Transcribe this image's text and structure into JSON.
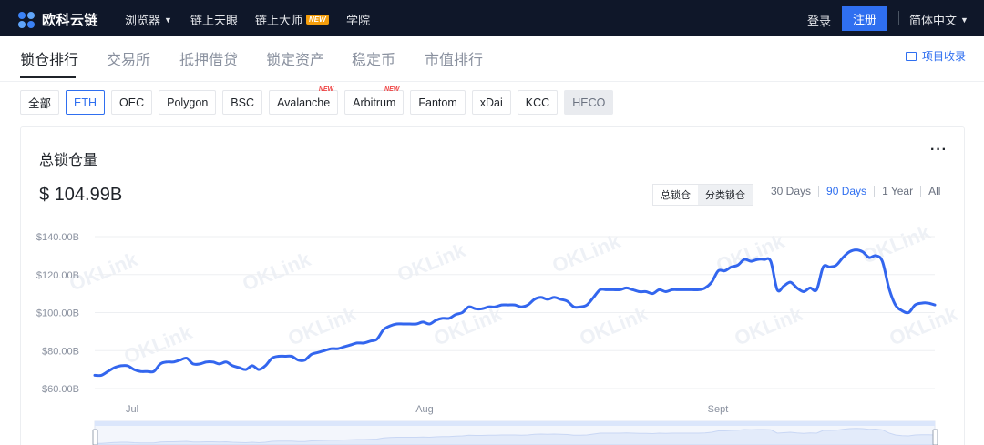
{
  "nav": {
    "logo_text": "欧科云链",
    "items": [
      {
        "label": "浏览器",
        "has_caret": true
      },
      {
        "label": "链上天眼"
      },
      {
        "label": "链上大师",
        "badge": "NEW"
      },
      {
        "label": "学院"
      }
    ],
    "login": "登录",
    "register": "注册",
    "language": "简体中文"
  },
  "tabs": [
    "锁仓排行",
    "交易所",
    "抵押借贷",
    "锁定资产",
    "稳定币",
    "市值排行"
  ],
  "active_tab": "锁仓排行",
  "collect_label": "项目收录",
  "chains": [
    {
      "label": "全部"
    },
    {
      "label": "ETH",
      "active": true
    },
    {
      "label": "OEC"
    },
    {
      "label": "Polygon"
    },
    {
      "label": "BSC"
    },
    {
      "label": "Avalanche",
      "badge": "NEW"
    },
    {
      "label": "Arbitrum",
      "badge": "NEW"
    },
    {
      "label": "Fantom"
    },
    {
      "label": "xDai"
    },
    {
      "label": "KCC"
    },
    {
      "label": "HECO",
      "muted": true
    }
  ],
  "card": {
    "title": "总锁仓量",
    "more": "···",
    "value": "$ 104.99B",
    "segments": [
      "总锁仓",
      "分类锁仓"
    ],
    "active_segment": "总锁仓",
    "ranges": [
      "30 Days",
      "90 Days",
      "1 Year",
      "All"
    ],
    "active_range": "90 Days"
  },
  "watermark": "OKLink",
  "colors": {
    "accent": "#2f6ff0",
    "line": "#3366ee",
    "nav_bg": "#0f1729"
  },
  "chart_data": {
    "type": "line",
    "title": "",
    "xlabel": "",
    "ylabel": "",
    "x_tick_labels": [
      "Jul",
      "Aug",
      "Sept"
    ],
    "y_tick_labels": [
      "$60.00B",
      "$80.00B",
      "$100.00B",
      "$120.00B",
      "$140.00B"
    ],
    "ylim": [
      60,
      140
    ],
    "grid": true,
    "series": [
      {
        "values": [
          67,
          67,
          69,
          71,
          72,
          72,
          70,
          69,
          69,
          69,
          73,
          74,
          74,
          75,
          76,
          73,
          73,
          74,
          74,
          73,
          74,
          72,
          71,
          70,
          72,
          70,
          72,
          76,
          77,
          77,
          77,
          75,
          75,
          78,
          79,
          80,
          81,
          81,
          82,
          83,
          84,
          84,
          85,
          86,
          91,
          93,
          94,
          94,
          94,
          94,
          95,
          94,
          96,
          97,
          97,
          99,
          100,
          103,
          102,
          102,
          103,
          103,
          104,
          104,
          104,
          103,
          104,
          107,
          108,
          107,
          108,
          107,
          106,
          103,
          103,
          104,
          108,
          112,
          112,
          112,
          112,
          113,
          112,
          111,
          111,
          110,
          112,
          111,
          112,
          112,
          112,
          112,
          112,
          113,
          116,
          122,
          122,
          124,
          125,
          128,
          127,
          128,
          128,
          127,
          112,
          114,
          116,
          113,
          111,
          113,
          112,
          124,
          124,
          125,
          129,
          132,
          133,
          132,
          129,
          130,
          127,
          113,
          104,
          101,
          100,
          104,
          105,
          105,
          104
        ]
      }
    ]
  }
}
